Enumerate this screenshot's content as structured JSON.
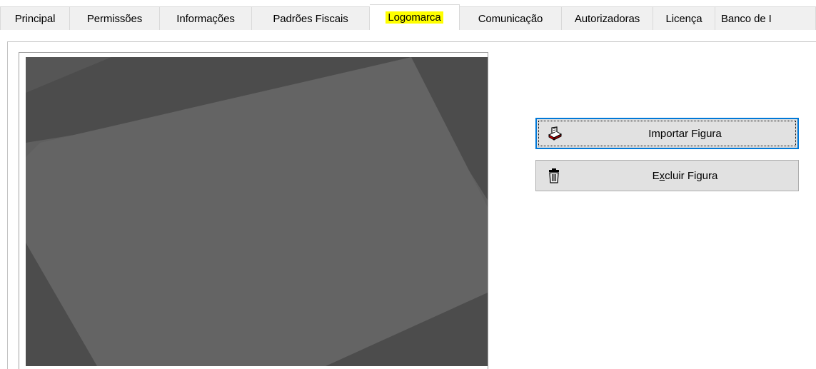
{
  "tabs": [
    {
      "label": "Principal",
      "width": 98
    },
    {
      "label": "Permissões",
      "width": 126
    },
    {
      "label": "Informações",
      "width": 129
    },
    {
      "label": "Padrões Fiscais",
      "width": 165
    },
    {
      "label": "Logomarca",
      "width": 126,
      "active": true
    },
    {
      "label": "Comunicação",
      "width": 143
    },
    {
      "label": "Autorizadoras",
      "width": 128
    },
    {
      "label": "Licença",
      "width": 87
    },
    {
      "label": "Banco de I",
      "width": 141
    }
  ],
  "active_tab": "Logomarca",
  "colors": {
    "active_tab_highlight": "#ffff00",
    "image_background": "#5f5f5f",
    "image_shade": "#4c4c4c",
    "focus_border": "#0078d7"
  },
  "buttons": {
    "import": {
      "label": "Importar Figura",
      "icon": "printer-icon",
      "focused": true
    },
    "delete": {
      "label_before_mnemonic": "E",
      "mnemonic": "x",
      "label_after_mnemonic": "cluir Figura",
      "label": "Excluir Figura",
      "icon": "trash-icon"
    }
  },
  "image_placeholder": {
    "icon": "empty-image-placeholder"
  }
}
